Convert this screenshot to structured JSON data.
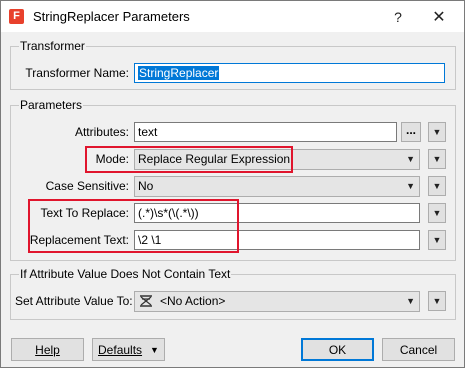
{
  "window": {
    "title": "StringReplacer Parameters",
    "app_icon_glyph": "F",
    "help_glyph": "?",
    "close_glyph": "✕"
  },
  "transformer_group": {
    "title": "Transformer",
    "name_label": "Transformer Name:",
    "name_value": "StringReplacer"
  },
  "parameters_group": {
    "title": "Parameters",
    "attributes_label": "Attributes:",
    "attributes_value": "text",
    "attributes_browse": "...",
    "mode_label": "Mode:",
    "mode_value": "Replace Regular Expression",
    "case_label": "Case Sensitive:",
    "case_value": "No",
    "text_to_replace_label": "Text To Replace:",
    "text_to_replace_value": "(.*)\\s*(\\(.*\\))",
    "replacement_label": "Replacement Text:",
    "replacement_value": "\\2 \\1"
  },
  "no_text_group": {
    "title": "If Attribute Value Does Not Contain Text",
    "set_label": "Set Attribute Value To:",
    "set_value": "<No Action>",
    "set_icon": "no-action-icon"
  },
  "buttons": {
    "help": "Help",
    "defaults": "Defaults",
    "ok": "OK",
    "cancel": "Cancel"
  },
  "colors": {
    "highlight": "#e0152d",
    "accent": "#0078d7"
  }
}
